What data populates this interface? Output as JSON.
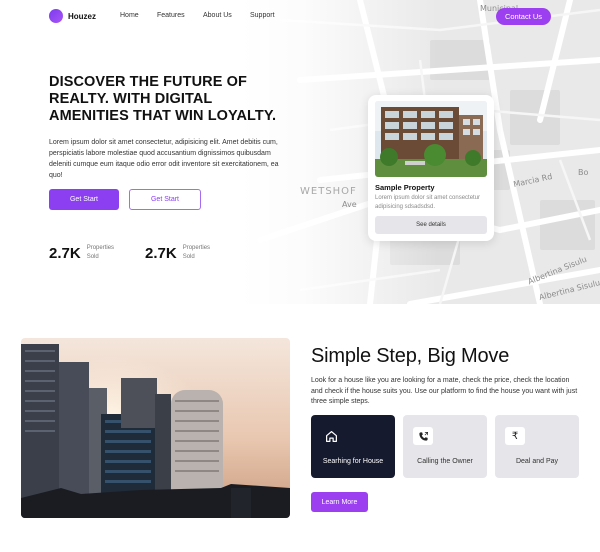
{
  "nav": {
    "brand": "Houzez",
    "links": [
      "Home",
      "Features",
      "About Us",
      "Support"
    ],
    "contact_label": "Contact Us"
  },
  "map": {
    "labels": [
      "Municipal",
      "Marcia Rd",
      "WETSHOF",
      "Ave",
      "Albertina Sisulu",
      "Albertina Sisulu Rd",
      "Bo"
    ]
  },
  "hero": {
    "headline": "DISCOVER THE FUTURE OF REALTY. WITH DIGITAL AMENITIES THAT WIN LOYALTY.",
    "lead": "Lorem ipsum dolor sit amet consectetur, adipisicing elit. Amet debitis cum, perspiciatis labore molestiae quod accusantium dignissimos quibusdam deleniti cumque eum itaque odio error odit inventore sit exercitationem, ea quo!",
    "primary_label": "Get Start",
    "secondary_label": "Get Start",
    "stats": [
      {
        "value": "2.7K",
        "label": "Properties Sold"
      },
      {
        "value": "2.7K",
        "label": "Properties Sold"
      }
    ]
  },
  "property_card": {
    "title": "Sample Property",
    "desc": "Lorem ipsum dolor sit amet consectetur adipisicing sdsadsdsd.",
    "button": "See details"
  },
  "steps": {
    "title": "Simple Step, Big Move",
    "lead": "Look for a house like you are looking for a mate, check the price, check the location and check if the house suits you. Use our platform to find the house you want with just three simple steps.",
    "cards": [
      {
        "label": "Searhing for House",
        "icon": "home-icon",
        "active": true
      },
      {
        "label": "Calling the Owner",
        "icon": "phone-call-icon",
        "active": false
      },
      {
        "label": "Deal and Pay",
        "icon": "rupee-icon",
        "active": false
      }
    ],
    "cta": "Learn More"
  },
  "colors": {
    "accent": "#9b3ff0",
    "dark_card": "#161a2e",
    "muted_card": "#e6e6ea"
  }
}
